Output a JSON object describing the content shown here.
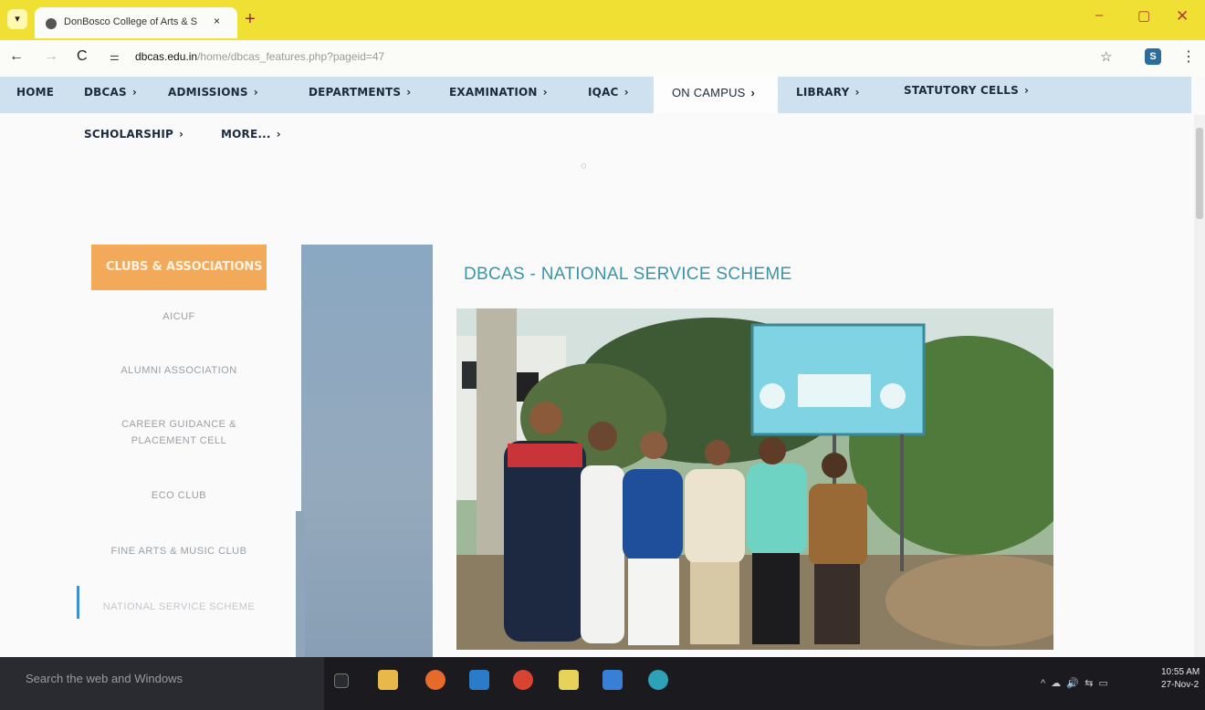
{
  "browser": {
    "tab_title": "DonBosco College of Arts & S",
    "tab_close": "×",
    "new_tab": "+",
    "url_host": "dbcas.edu.in",
    "url_path": "/home/dbcas_features.php?pageid=47",
    "icons": {
      "back": "←",
      "forward": "→",
      "reload": "C",
      "star": "☆",
      "menu": "⋮",
      "minimize": "–",
      "maximize": "▢",
      "close": "✕"
    }
  },
  "nav": {
    "row1": [
      {
        "label": "HOME",
        "chevron": ""
      },
      {
        "label": "DBCAS",
        "chevron": "›"
      },
      {
        "label": "ADMISSIONS",
        "chevron": "›"
      },
      {
        "label": "DEPARTMENTS",
        "chevron": "›"
      },
      {
        "label": "EXAMINATION",
        "chevron": "›"
      },
      {
        "label": "IQAC",
        "chevron": "›"
      },
      {
        "label": "ON CAMPUS",
        "chevron": "›"
      },
      {
        "label": "LIBRARY",
        "chevron": "›"
      },
      {
        "label": "STATUTORY CELLS",
        "chevron": "›"
      }
    ],
    "row2": [
      {
        "label": "SCHOLARSHIP",
        "chevron": "›"
      },
      {
        "label": "MORE...",
        "chevron": "›"
      }
    ]
  },
  "sidebar": {
    "header": "CLUBS & ASSOCIATIONS",
    "items": [
      "AICUF",
      "ALUMNI ASSOCIATION",
      "CAREER GUIDANCE &",
      "PLACEMENT CELL",
      "ECO CLUB",
      "FINE ARTS & MUSIC CLUB",
      "NATIONAL SERVICE SCHEME"
    ]
  },
  "main": {
    "title": "DBCAS - NATIONAL SERVICE SCHEME"
  },
  "taskbar": {
    "search_placeholder": "Search the web and Windows",
    "clock_time": "10:55 AM",
    "clock_date": "27-Nov-2"
  },
  "colors": {
    "tabstrip": "#f0e033",
    "nav_bg": "#cfe0ee",
    "clubs_header": "#f2a95a",
    "title": "#3a95a8",
    "active_bar": "#3c8fd1"
  }
}
